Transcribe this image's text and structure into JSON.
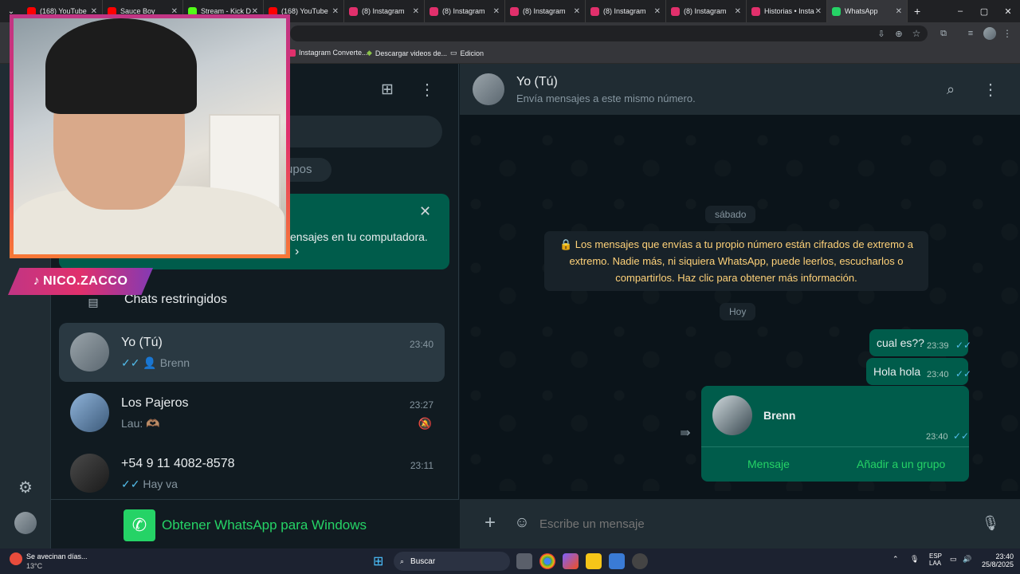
{
  "browser": {
    "tabs": [
      {
        "label": "(168) YouTube",
        "color": "#ff0000"
      },
      {
        "label": "Sauce Boy",
        "color": "#ff0000"
      },
      {
        "label": "Stream - Kick D",
        "color": "#53fc18"
      },
      {
        "label": "(168) YouTube",
        "color": "#ff0000"
      },
      {
        "label": "(8) Instagram",
        "color": "#e1306c"
      },
      {
        "label": "(8) Instagram",
        "color": "#e1306c"
      },
      {
        "label": "(8) Instagram",
        "color": "#e1306c"
      },
      {
        "label": "(8) Instagram",
        "color": "#e1306c"
      },
      {
        "label": "(8) Instagram",
        "color": "#e1306c"
      },
      {
        "label": "Historias • Insta",
        "color": "#e1306c"
      },
      {
        "label": "WhatsApp",
        "color": "#25d366"
      }
    ],
    "new_tab": "+",
    "window_controls": [
      "–",
      "▢",
      "✕"
    ],
    "bookmarks": [
      {
        "label": "Instagram Converte..."
      },
      {
        "label": "Descargar videos de..."
      },
      {
        "label": "Edicion"
      }
    ]
  },
  "overlay": {
    "handle": "NICO.ZACCO"
  },
  "sidebar": {
    "search_placeholder": "",
    "filter_partial": "rupos",
    "banner": {
      "text_partial": "ensajes en tu computadora.",
      "chevron": "›",
      "close": "✕"
    },
    "restricted_label": "Chats restringidos",
    "chats": [
      {
        "name": "Yo (Tú)",
        "time": "23:40",
        "preview": "Brenn",
        "ticks": "✓✓",
        "person_icon": true,
        "selected": true
      },
      {
        "name": "Los Pajeros",
        "time": "23:27",
        "preview": "Lau: 🫶🏽",
        "muted": true
      },
      {
        "name": "+54 9 11 4082-8578",
        "time": "23:11",
        "preview": "Hay va",
        "ticks": "✓✓"
      }
    ],
    "get_app": "Obtener WhatsApp para Windows"
  },
  "chat": {
    "header": {
      "name": "Yo (Tú)",
      "subtitle": "Envía mensajes a este mismo número."
    },
    "date_saturday": "sábado",
    "encryption_notice": "Los mensajes que envías a tu propio número están cifrados de extremo a extremo. Nadie más, ni siquiera WhatsApp, puede leerlos, escucharlos o compartirlos. Haz clic para obtener más información.",
    "date_today": "Hoy",
    "messages": [
      {
        "text": "cual es??",
        "time": "23:39",
        "ticks": "✓✓"
      },
      {
        "text": "Hola hola",
        "time": "23:40",
        "ticks": "✓✓"
      }
    ],
    "contact_card": {
      "name": "Brenn",
      "time": "23:40",
      "ticks": "✓✓",
      "action_message": "Mensaje",
      "action_add": "Añadir a un grupo"
    },
    "composer_placeholder": "Escribe un mensaje"
  },
  "taskbar": {
    "weather_title": "Se avecinan días...",
    "weather_temp": "13°C",
    "search_label": "Buscar",
    "lang_line1": "ESP",
    "lang_line2": "LAA",
    "clock_time": "23:40",
    "clock_date": "25/8/2025"
  },
  "colors": {
    "accent": "#25d366",
    "bubble": "#005c4b",
    "panel": "#202c33"
  }
}
